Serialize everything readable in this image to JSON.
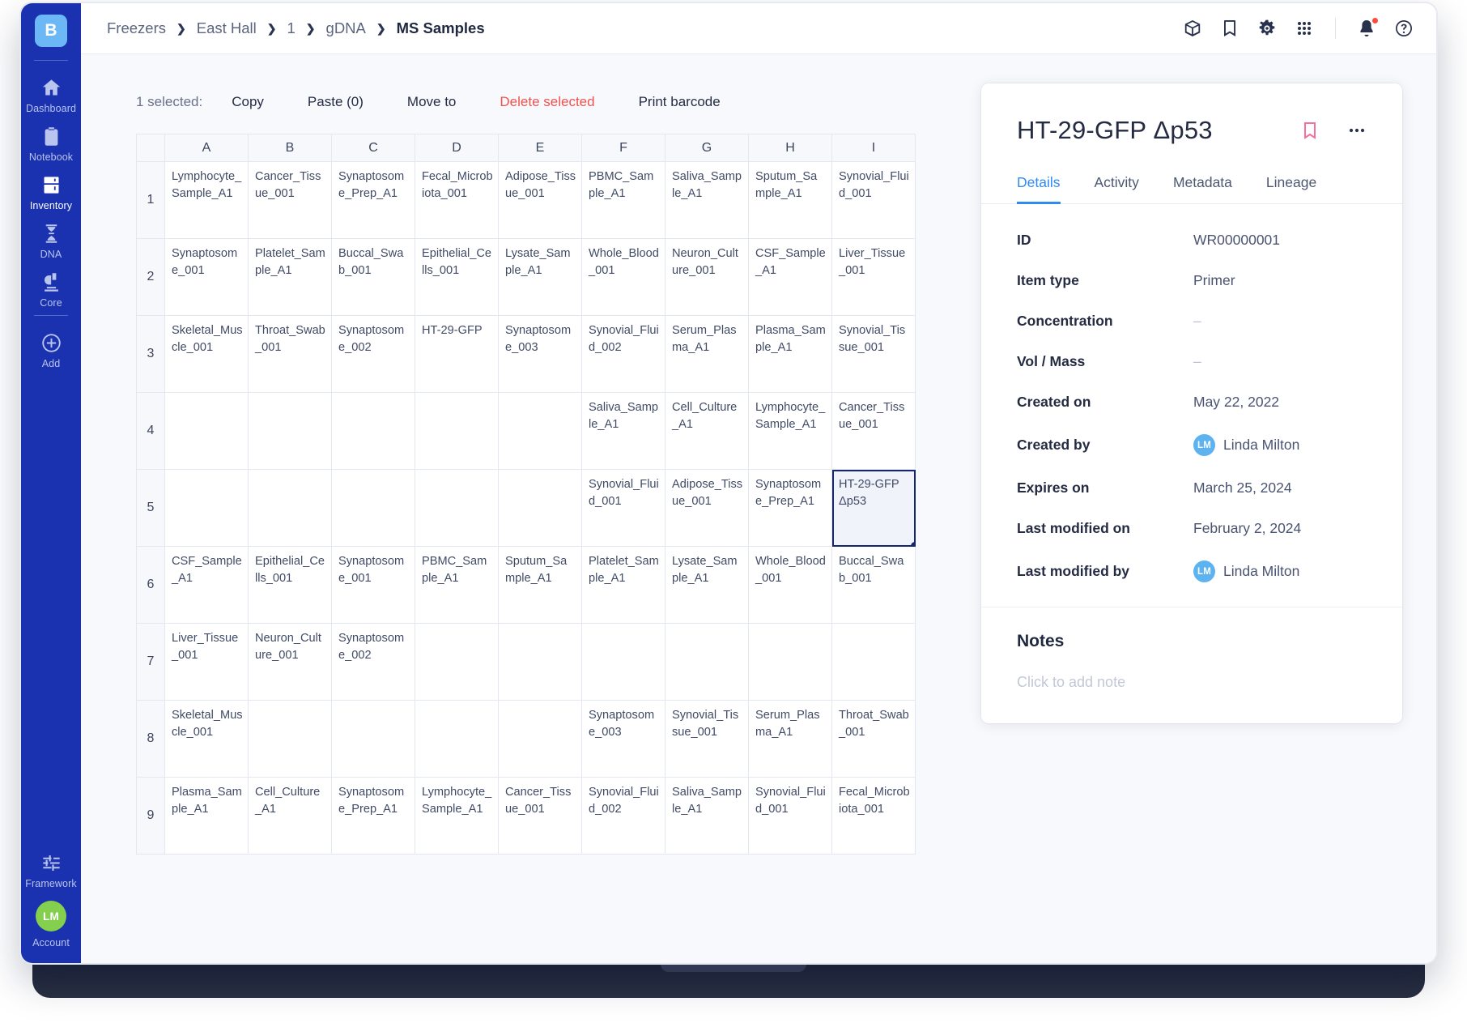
{
  "sidebar": {
    "logo": "B",
    "items": [
      {
        "label": "Dashboard",
        "icon": "home-icon",
        "active": false
      },
      {
        "label": "Notebook",
        "icon": "clipboard-icon",
        "active": false
      },
      {
        "label": "Inventory",
        "icon": "freezer-icon",
        "active": true
      },
      {
        "label": "DNA",
        "icon": "dna-helix-icon",
        "active": false
      },
      {
        "label": "Core",
        "icon": "microscope-icon",
        "active": false
      },
      {
        "label": "Add",
        "icon": "plus-circle-icon",
        "active": false
      }
    ],
    "bottom": [
      {
        "label": "Framework",
        "icon": "sliders-icon"
      },
      {
        "label": "Account",
        "icon": "avatar",
        "initials": "LM"
      }
    ]
  },
  "header": {
    "breadcrumb": [
      "Freezers",
      "East Hall",
      "1",
      "gDNA",
      "MS Samples"
    ],
    "icons": [
      "box-icon",
      "bookmark-icon",
      "gear-icon",
      "grid-apps-icon",
      "bell-icon",
      "help-circle-icon"
    ]
  },
  "toolbar": {
    "selection_label": "1 selected:",
    "actions": [
      {
        "label": "Copy",
        "danger": false
      },
      {
        "label": "Paste (0)",
        "danger": false
      },
      {
        "label": "Move to",
        "danger": false
      },
      {
        "label": "Delete selected",
        "danger": true
      },
      {
        "label": "Print barcode",
        "danger": false
      }
    ]
  },
  "grid": {
    "columns": [
      "A",
      "B",
      "C",
      "D",
      "E",
      "F",
      "G",
      "H",
      "I"
    ],
    "rows": [
      "1",
      "2",
      "3",
      "4",
      "5",
      "6",
      "7",
      "8",
      "9"
    ],
    "selected_cell": "I5",
    "cells": [
      [
        "Lymphocyte_Sample_A1",
        "Cancer_Tissue_001",
        "Synaptosome_Prep_A1",
        "Fecal_Microbiota_001",
        "Adipose_Tissue_001",
        "PBMC_Sample_A1",
        "Saliva_Sample_A1",
        "Sputum_Sample_A1",
        "Synovial_Fluid_001"
      ],
      [
        "Synaptosome_001",
        "Platelet_Sample_A1",
        "Buccal_Swab_001",
        "Epithelial_Cells_001",
        "Lysate_Sample_A1",
        "Whole_Blood_001",
        "Neuron_Culture_001",
        "CSF_Sample_A1",
        "Liver_Tissue_001"
      ],
      [
        "Skeletal_Muscle_001",
        "Throat_Swab_001",
        "Synaptosome_002",
        "HT-29-GFP",
        "Synaptosome_003",
        "Synovial_Fluid_002",
        "Serum_Plasma_A1",
        "Plasma_Sample_A1",
        "Synovial_Tissue_001"
      ],
      [
        "",
        "",
        "",
        "",
        "",
        "Saliva_Sample_A1",
        "Cell_Culture_A1",
        "Lymphocyte_Sample_A1",
        "Cancer_Tissue_001"
      ],
      [
        "",
        "",
        "",
        "",
        "",
        "Synovial_Fluid_001",
        "Adipose_Tissue_001",
        "Synaptosome_Prep_A1",
        "HT-29-GFP Δp53"
      ],
      [
        "CSF_Sample_A1",
        "Epithelial_Cells_001",
        "Synaptosome_001",
        "PBMC_Sample_A1",
        "Sputum_Sample_A1",
        "Platelet_Sample_A1",
        "Lysate_Sample_A1",
        "Whole_Blood_001",
        "Buccal_Swab_001"
      ],
      [
        "Liver_Tissue_001",
        "Neuron_Culture_001",
        "Synaptosome_002",
        "",
        "",
        "",
        "",
        "",
        ""
      ],
      [
        "Skeletal_Muscle_001",
        "",
        "",
        "",
        "",
        "Synaptosome_003",
        "Synovial_Tissue_001",
        "Serum_Plasma_A1",
        "Throat_Swab_001"
      ],
      [
        "Plasma_Sample_A1",
        "Cell_Culture_A1",
        "Synaptosome_Prep_A1",
        "Lymphocyte_Sample_A1",
        "Cancer_Tissue_001",
        "Synovial_Fluid_002",
        "Saliva_Sample_A1",
        "Synovial_Fluid_001",
        "Fecal_Microbiota_001"
      ]
    ]
  },
  "detail": {
    "title": "HT-29-GFP Δp53",
    "bookmark_icon": "bookmark-icon",
    "more_icon": "more-horizontal-icon",
    "tabs": [
      {
        "label": "Details",
        "active": true
      },
      {
        "label": "Activity",
        "active": false
      },
      {
        "label": "Metadata",
        "active": false
      },
      {
        "label": "Lineage",
        "active": false
      }
    ],
    "fields": [
      {
        "label": "ID",
        "value": "WR00000001",
        "muted": false,
        "avatar": ""
      },
      {
        "label": "Item type",
        "value": "Primer",
        "muted": false,
        "avatar": ""
      },
      {
        "label": "Concentration",
        "value": "–",
        "muted": true,
        "avatar": ""
      },
      {
        "label": "Vol / Mass",
        "value": "–",
        "muted": true,
        "avatar": ""
      },
      {
        "label": "Created on",
        "value": "May 22, 2022",
        "muted": false,
        "avatar": ""
      },
      {
        "label": "Created by",
        "value": "Linda Milton",
        "muted": false,
        "avatar": "LM"
      },
      {
        "label": "Expires on",
        "value": "March 25, 2024",
        "muted": false,
        "avatar": ""
      },
      {
        "label": "Last modified on",
        "value": "February 2, 2024",
        "muted": false,
        "avatar": ""
      },
      {
        "label": "Last modified by",
        "value": "Linda Milton",
        "muted": false,
        "avatar": "LM"
      }
    ],
    "notes": {
      "title": "Notes",
      "placeholder": "Click to add note"
    }
  },
  "colors": {
    "sidebar_bg": "#1a32b0",
    "accent_blue": "#2f8bf0",
    "danger_red": "#f2514d",
    "bookmark_pink": "#f56fa1",
    "selection_border": "#16266e",
    "account_green": "#84cf4e"
  }
}
